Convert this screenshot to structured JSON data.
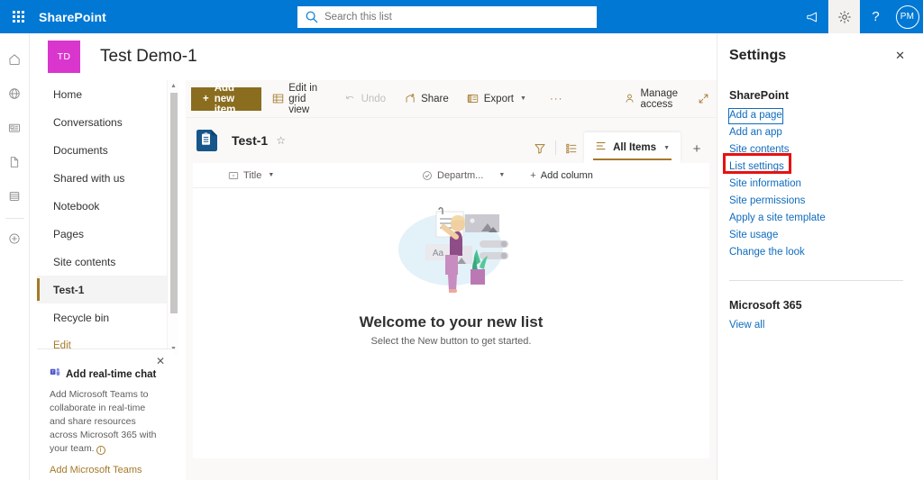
{
  "suite": {
    "brand": "SharePoint",
    "waffle_name": "app-launcher",
    "search_placeholder": "Search this list",
    "search_value": "",
    "icons": {
      "megaphone": "megaphone-icon",
      "settings": "gear-icon",
      "help": "?",
      "avatar_initials": "PM"
    },
    "colors": {
      "header_bg": "#0078d4",
      "active_btn_bg": "#f3f2f1"
    }
  },
  "rail": {
    "items": [
      {
        "name": "home-icon",
        "label": "Home"
      },
      {
        "name": "globe-icon",
        "label": "My sites"
      },
      {
        "name": "news-icon",
        "label": "News"
      },
      {
        "name": "file-icon",
        "label": "Files"
      },
      {
        "name": "lists-icon",
        "label": "Lists"
      },
      {
        "name": "create-icon",
        "label": "Create"
      }
    ]
  },
  "site": {
    "avatar_initials": "TD",
    "avatar_color": "#d936cd",
    "title": "Test Demo-1"
  },
  "nav": {
    "items": [
      {
        "label": "Home",
        "selected": false
      },
      {
        "label": "Conversations",
        "selected": false
      },
      {
        "label": "Documents",
        "selected": false
      },
      {
        "label": "Shared with us",
        "selected": false
      },
      {
        "label": "Notebook",
        "selected": false
      },
      {
        "label": "Pages",
        "selected": false
      },
      {
        "label": "Site contents",
        "selected": false
      },
      {
        "label": "Test-1",
        "selected": true
      },
      {
        "label": "Recycle bin",
        "selected": false
      },
      {
        "label": "Edit",
        "selected": false
      }
    ]
  },
  "promo": {
    "title": "Add real-time chat",
    "body": "Add Microsoft Teams to collaborate in real-time and share resources across Microsoft 365 with your team.",
    "link": "Add Microsoft Teams",
    "close_label": "Close"
  },
  "toolbar": {
    "add_new_item": "Add new item",
    "edit_in_grid_view": "Edit in grid view",
    "undo": "Undo",
    "undo_disabled": true,
    "share": "Share",
    "export": "Export",
    "overflow": "···",
    "manage_access": "Manage access",
    "expand_label": "Full screen",
    "accent_color": "#8a6d1f"
  },
  "list": {
    "name": "Test-1",
    "favorite_label": "Add to favorites",
    "filter_label": "Filter",
    "details_label": "List pane",
    "view_name": "All Items",
    "add_view_label": "Add view",
    "columns": [
      {
        "label": "Title",
        "icon": "text-field-icon"
      },
      {
        "label": "Departm...",
        "icon": "choice-icon"
      }
    ],
    "add_column": "Add column",
    "empty_title": "Welcome to your new list",
    "empty_subtitle": "Select the New button to get started."
  },
  "panel": {
    "title": "Settings",
    "close_label": "Close",
    "sections": [
      {
        "heading": "SharePoint",
        "links": [
          {
            "label": "Add a page",
            "focused": true,
            "highlighted": false
          },
          {
            "label": "Add an app",
            "focused": false,
            "highlighted": false
          },
          {
            "label": "Site contents",
            "focused": false,
            "highlighted": false
          },
          {
            "label": "List settings",
            "focused": false,
            "highlighted": true
          },
          {
            "label": "Site information",
            "focused": false,
            "highlighted": false
          },
          {
            "label": "Site permissions",
            "focused": false,
            "highlighted": false
          },
          {
            "label": "Apply a site template",
            "focused": false,
            "highlighted": false
          },
          {
            "label": "Site usage",
            "focused": false,
            "highlighted": false
          },
          {
            "label": "Change the look",
            "focused": false,
            "highlighted": false
          }
        ]
      },
      {
        "heading": "Microsoft 365",
        "links": [
          {
            "label": "View all",
            "focused": false,
            "highlighted": false
          }
        ]
      }
    ],
    "highlight_color": "#e81111",
    "link_color": "#0f6cbd"
  }
}
